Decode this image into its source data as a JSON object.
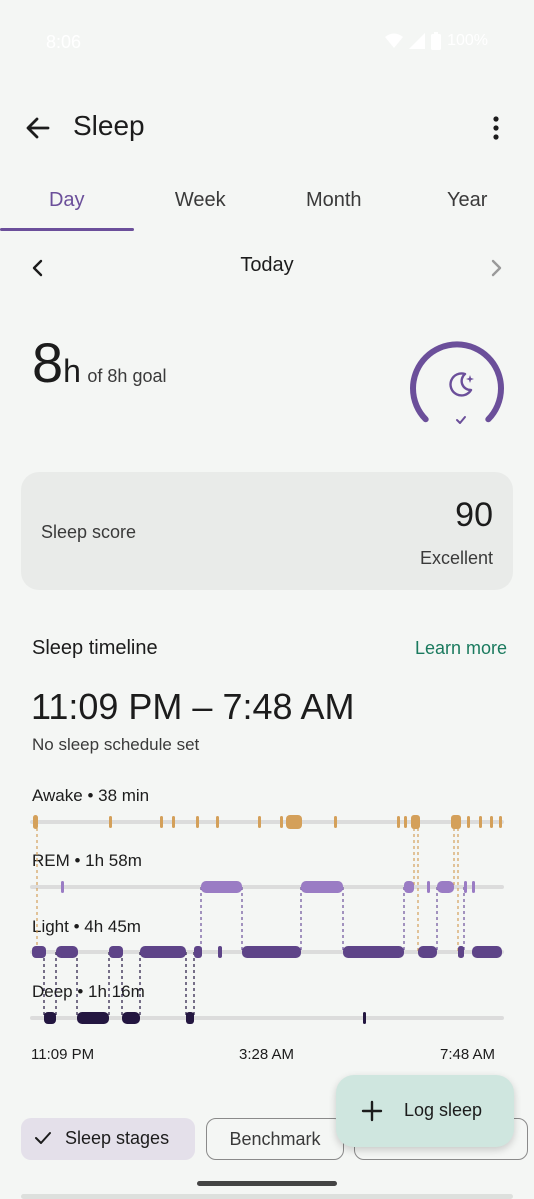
{
  "status_bar": {
    "time": "8:06",
    "battery": "100%"
  },
  "header": {
    "title": "Sleep"
  },
  "tabs": [
    {
      "label": "Day",
      "active": true
    },
    {
      "label": "Week",
      "active": false
    },
    {
      "label": "Month",
      "active": false
    },
    {
      "label": "Year",
      "active": false
    }
  ],
  "date_nav": {
    "label": "Today"
  },
  "summary": {
    "hours": "8",
    "unit": "h",
    "goal_text": "of 8h goal",
    "goal_progress": 1.0
  },
  "score_card": {
    "label": "Sleep score",
    "value": "90",
    "description": "Excellent"
  },
  "timeline": {
    "heading": "Sleep timeline",
    "learn_more": "Learn more",
    "range": "11:09 PM – 7:48 AM",
    "note": "No sleep schedule set",
    "stages": [
      {
        "label": "Awake • 38 min"
      },
      {
        "label": "REM • 1h 58m"
      },
      {
        "label": "Light • 4h 45m"
      },
      {
        "label": "Deep • 1h 16m"
      }
    ],
    "axis": {
      "start": "11:09 PM",
      "mid": "3:28 AM",
      "end": "7:48 AM"
    }
  },
  "colors": {
    "accent": "#6b4f9a",
    "awake": "#d4a05a",
    "rem": "#9a7cc4",
    "light": "#5e4488",
    "deep": "#231640",
    "link": "#1a7a5e"
  },
  "fab": {
    "label": "Log sleep"
  },
  "chips": {
    "sleep_stages": "Sleep stages",
    "benchmark": "Benchmark"
  }
}
